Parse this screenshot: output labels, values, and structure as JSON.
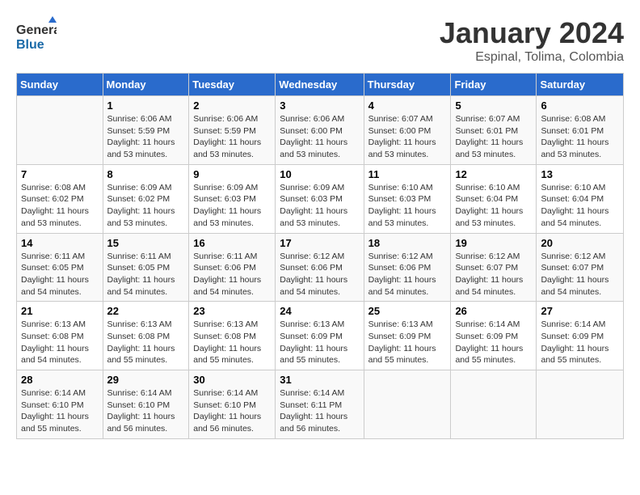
{
  "header": {
    "logo_general": "General",
    "logo_blue": "Blue",
    "title": "January 2024",
    "subtitle": "Espinal, Tolima, Colombia"
  },
  "days_of_week": [
    "Sunday",
    "Monday",
    "Tuesday",
    "Wednesday",
    "Thursday",
    "Friday",
    "Saturday"
  ],
  "weeks": [
    [
      {
        "day": "",
        "info": ""
      },
      {
        "day": "1",
        "info": "Sunrise: 6:06 AM\nSunset: 5:59 PM\nDaylight: 11 hours and 53 minutes."
      },
      {
        "day": "2",
        "info": "Sunrise: 6:06 AM\nSunset: 5:59 PM\nDaylight: 11 hours and 53 minutes."
      },
      {
        "day": "3",
        "info": "Sunrise: 6:06 AM\nSunset: 6:00 PM\nDaylight: 11 hours and 53 minutes."
      },
      {
        "day": "4",
        "info": "Sunrise: 6:07 AM\nSunset: 6:00 PM\nDaylight: 11 hours and 53 minutes."
      },
      {
        "day": "5",
        "info": "Sunrise: 6:07 AM\nSunset: 6:01 PM\nDaylight: 11 hours and 53 minutes."
      },
      {
        "day": "6",
        "info": "Sunrise: 6:08 AM\nSunset: 6:01 PM\nDaylight: 11 hours and 53 minutes."
      }
    ],
    [
      {
        "day": "7",
        "info": "Sunrise: 6:08 AM\nSunset: 6:02 PM\nDaylight: 11 hours and 53 minutes."
      },
      {
        "day": "8",
        "info": "Sunrise: 6:09 AM\nSunset: 6:02 PM\nDaylight: 11 hours and 53 minutes."
      },
      {
        "day": "9",
        "info": "Sunrise: 6:09 AM\nSunset: 6:03 PM\nDaylight: 11 hours and 53 minutes."
      },
      {
        "day": "10",
        "info": "Sunrise: 6:09 AM\nSunset: 6:03 PM\nDaylight: 11 hours and 53 minutes."
      },
      {
        "day": "11",
        "info": "Sunrise: 6:10 AM\nSunset: 6:03 PM\nDaylight: 11 hours and 53 minutes."
      },
      {
        "day": "12",
        "info": "Sunrise: 6:10 AM\nSunset: 6:04 PM\nDaylight: 11 hours and 53 minutes."
      },
      {
        "day": "13",
        "info": "Sunrise: 6:10 AM\nSunset: 6:04 PM\nDaylight: 11 hours and 54 minutes."
      }
    ],
    [
      {
        "day": "14",
        "info": "Sunrise: 6:11 AM\nSunset: 6:05 PM\nDaylight: 11 hours and 54 minutes."
      },
      {
        "day": "15",
        "info": "Sunrise: 6:11 AM\nSunset: 6:05 PM\nDaylight: 11 hours and 54 minutes."
      },
      {
        "day": "16",
        "info": "Sunrise: 6:11 AM\nSunset: 6:06 PM\nDaylight: 11 hours and 54 minutes."
      },
      {
        "day": "17",
        "info": "Sunrise: 6:12 AM\nSunset: 6:06 PM\nDaylight: 11 hours and 54 minutes."
      },
      {
        "day": "18",
        "info": "Sunrise: 6:12 AM\nSunset: 6:06 PM\nDaylight: 11 hours and 54 minutes."
      },
      {
        "day": "19",
        "info": "Sunrise: 6:12 AM\nSunset: 6:07 PM\nDaylight: 11 hours and 54 minutes."
      },
      {
        "day": "20",
        "info": "Sunrise: 6:12 AM\nSunset: 6:07 PM\nDaylight: 11 hours and 54 minutes."
      }
    ],
    [
      {
        "day": "21",
        "info": "Sunrise: 6:13 AM\nSunset: 6:08 PM\nDaylight: 11 hours and 54 minutes."
      },
      {
        "day": "22",
        "info": "Sunrise: 6:13 AM\nSunset: 6:08 PM\nDaylight: 11 hours and 55 minutes."
      },
      {
        "day": "23",
        "info": "Sunrise: 6:13 AM\nSunset: 6:08 PM\nDaylight: 11 hours and 55 minutes."
      },
      {
        "day": "24",
        "info": "Sunrise: 6:13 AM\nSunset: 6:09 PM\nDaylight: 11 hours and 55 minutes."
      },
      {
        "day": "25",
        "info": "Sunrise: 6:13 AM\nSunset: 6:09 PM\nDaylight: 11 hours and 55 minutes."
      },
      {
        "day": "26",
        "info": "Sunrise: 6:14 AM\nSunset: 6:09 PM\nDaylight: 11 hours and 55 minutes."
      },
      {
        "day": "27",
        "info": "Sunrise: 6:14 AM\nSunset: 6:09 PM\nDaylight: 11 hours and 55 minutes."
      }
    ],
    [
      {
        "day": "28",
        "info": "Sunrise: 6:14 AM\nSunset: 6:10 PM\nDaylight: 11 hours and 55 minutes."
      },
      {
        "day": "29",
        "info": "Sunrise: 6:14 AM\nSunset: 6:10 PM\nDaylight: 11 hours and 56 minutes."
      },
      {
        "day": "30",
        "info": "Sunrise: 6:14 AM\nSunset: 6:10 PM\nDaylight: 11 hours and 56 minutes."
      },
      {
        "day": "31",
        "info": "Sunrise: 6:14 AM\nSunset: 6:11 PM\nDaylight: 11 hours and 56 minutes."
      },
      {
        "day": "",
        "info": ""
      },
      {
        "day": "",
        "info": ""
      },
      {
        "day": "",
        "info": ""
      }
    ]
  ]
}
